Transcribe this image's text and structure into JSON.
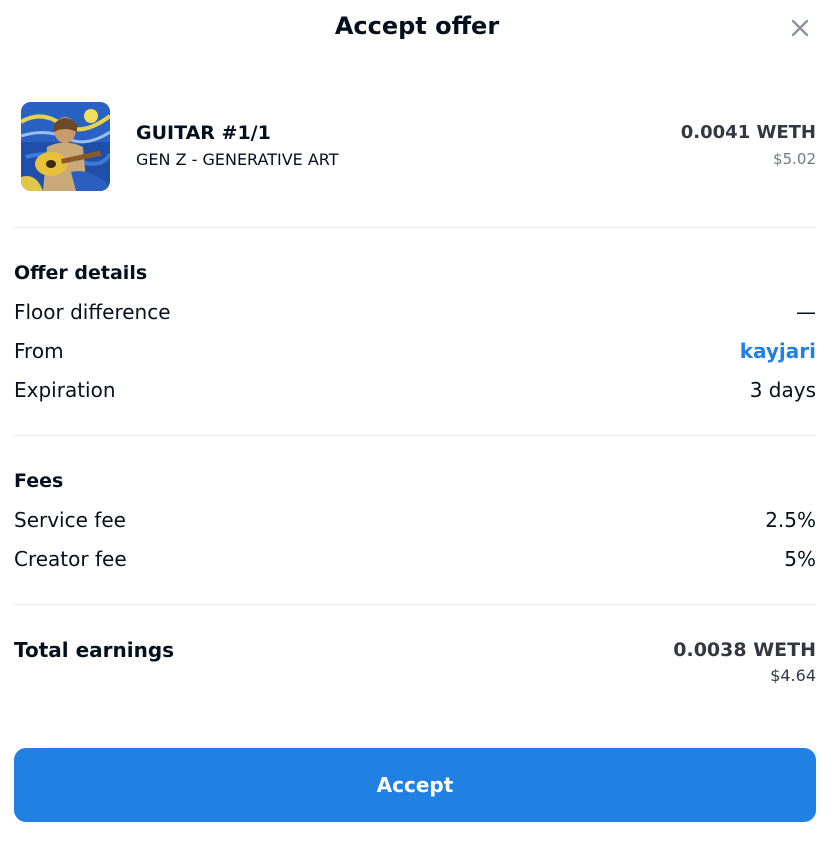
{
  "header": {
    "title": "Accept offer",
    "close_icon": "close-icon"
  },
  "item": {
    "name": "GUITAR #1/1",
    "collection": "GEN Z - GENERATIVE ART",
    "price": "0.0041 WETH",
    "price_usd": "$5.02",
    "image_icon": "artwork-thumbnail"
  },
  "offer_details": {
    "title": "Offer details",
    "rows": [
      {
        "label": "Floor difference",
        "value": "—"
      },
      {
        "label": "From",
        "value": "kayjari"
      },
      {
        "label": "Expiration",
        "value": "3 days"
      }
    ]
  },
  "fees": {
    "title": "Fees",
    "rows": [
      {
        "label": "Service fee",
        "value": "2.5%"
      },
      {
        "label": "Creator fee",
        "value": "5%"
      }
    ]
  },
  "total": {
    "label": "Total earnings",
    "value": "0.0038 WETH",
    "usd": "$4.64"
  },
  "actions": {
    "accept_label": "Accept"
  },
  "colors": {
    "accent": "#2081e2",
    "text": "#04111d",
    "muted": "#707a83",
    "divider": "#e5e8eb"
  }
}
